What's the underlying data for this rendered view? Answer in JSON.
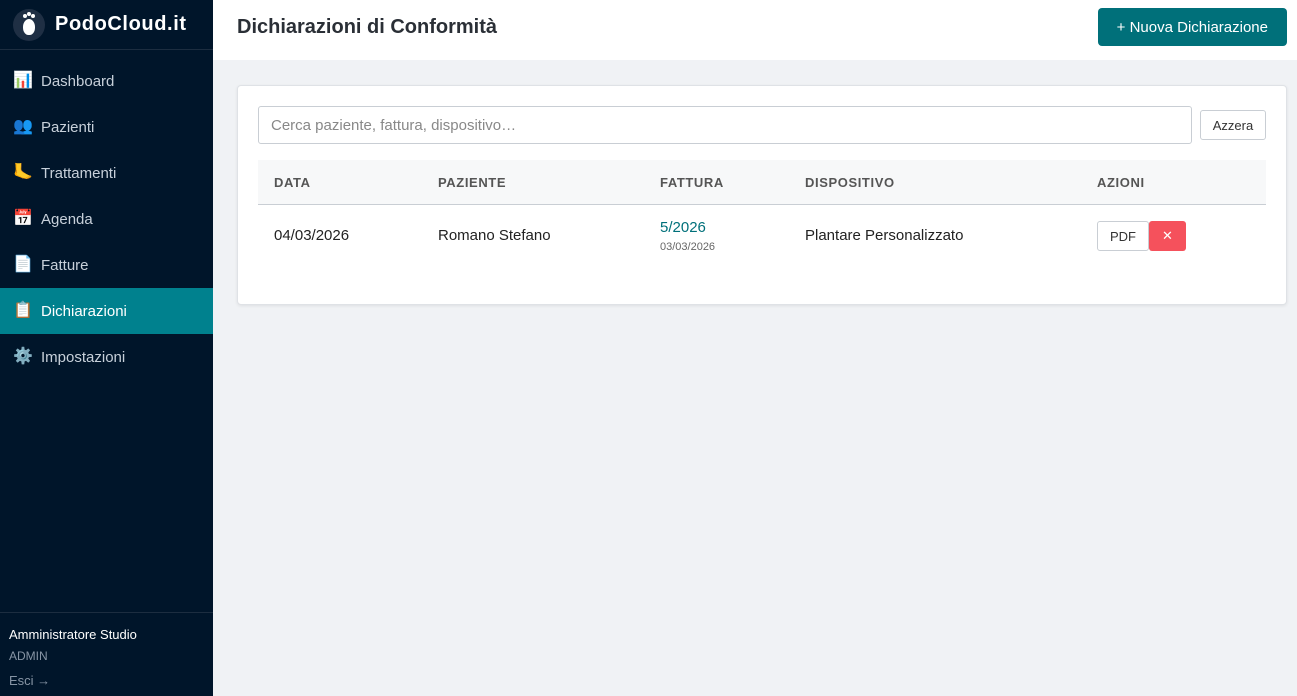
{
  "app": {
    "name": "PodoCloud.it"
  },
  "sidebar": {
    "items": [
      {
        "label": "Dashboard",
        "icon": "📊",
        "icon_name": "bar-chart-icon",
        "active": false
      },
      {
        "label": "Pazienti",
        "icon": "👥",
        "icon_name": "people-icon",
        "active": false
      },
      {
        "label": "Trattamenti",
        "icon": "🦶",
        "icon_name": "foot-icon",
        "active": false
      },
      {
        "label": "Agenda",
        "icon": "📅",
        "icon_name": "calendar-icon",
        "active": false
      },
      {
        "label": "Fatture",
        "icon": "📄",
        "icon_name": "document-icon",
        "active": false
      },
      {
        "label": "Dichiarazioni",
        "icon": "📋",
        "icon_name": "clipboard-icon",
        "active": true
      },
      {
        "label": "Impostazioni",
        "icon": "⚙️",
        "icon_name": "gear-icon",
        "active": false
      }
    ],
    "user": {
      "name": "Amministratore Studio",
      "role": "ADMIN",
      "logout": "Esci →"
    }
  },
  "header": {
    "title": "Dichiarazioni di Conformità",
    "new_button": "+ Nuova Dichiarazione"
  },
  "search": {
    "placeholder": "Cerca paziente, fattura, dispositivo…",
    "value": "",
    "reset_label": "Azzera"
  },
  "table": {
    "columns": [
      "DATA",
      "PAZIENTE",
      "FATTURA",
      "DISPOSITIVO",
      "AZIONI"
    ],
    "rows": [
      {
        "data": "04/03/2026",
        "paziente": "Romano Stefano",
        "fattura_numero": "5/2026",
        "fattura_data": "03/03/2026",
        "dispositivo": "Plantare Personalizzato",
        "pdf_label": "PDF",
        "delete_label": "✕"
      }
    ]
  },
  "colors": {
    "sidebar_bg": "#00152a",
    "accent": "#00818e",
    "primary_button": "#00707a",
    "danger": "#f5515c"
  }
}
